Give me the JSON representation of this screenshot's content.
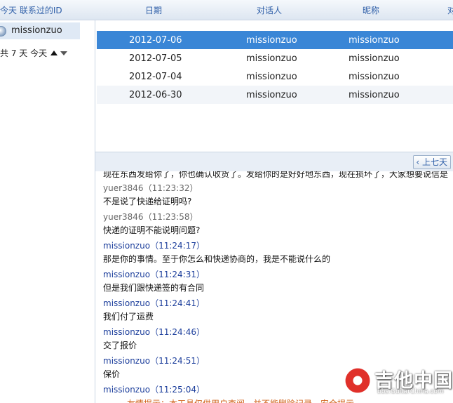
{
  "left_header": {
    "label": "今天 联系过的ID"
  },
  "contacts": [
    {
      "name": "missionzuo"
    }
  ],
  "range": {
    "text": "共 7 天 今天"
  },
  "table": {
    "columns": [
      "日期",
      "对话人",
      "昵称",
      "对"
    ],
    "rows": [
      {
        "date": "2012-07-06",
        "peer": "missionzuo",
        "nick": "missionzuo"
      },
      {
        "date": "2012-07-05",
        "peer": "missionzuo",
        "nick": "missionzuo"
      },
      {
        "date": "2012-07-04",
        "peer": "missionzuo",
        "nick": "missionzuo"
      },
      {
        "date": "2012-06-30",
        "peer": "missionzuo",
        "nick": "missionzuo"
      }
    ],
    "selected_index": 0
  },
  "pager": {
    "prev_label": "上七天"
  },
  "chat": {
    "top_cut": "现在东西发给你了，你也确认收货了。发给你的是好好地东西，现在损坏了，大家想要说信是",
    "messages": [
      {
        "sender": "yuer3846",
        "time": "（11:23:32）",
        "self": false,
        "text": "不是说了快递给证明吗?"
      },
      {
        "sender": "yuer3846",
        "time": "（11:23:58）",
        "self": false,
        "text": "快递的证明不能说明问题?"
      },
      {
        "sender": "missionzuo",
        "time": "（11:24:17）",
        "self": true,
        "text": "那是你的事情。至于你怎么和快递协商的，我是不能说什么的"
      },
      {
        "sender": "missionzuo",
        "time": "（11:24:31）",
        "self": true,
        "text": "但是我们跟快递签的有合同"
      },
      {
        "sender": "missionzuo",
        "time": "（11:24:41）",
        "self": true,
        "text": "我们付了运费"
      },
      {
        "sender": "missionzuo",
        "time": "（11:24:46）",
        "self": true,
        "text": "交了报价"
      },
      {
        "sender": "missionzuo",
        "time": "（11:24:51）",
        "self": true,
        "text": "保价"
      },
      {
        "sender": "missionzuo",
        "time": "（11:25:04）",
        "self": true,
        "text": ""
      }
    ]
  },
  "notice": {
    "text": "友情提示：本工具仅供用户查阅，并不能删除记录。安全提示"
  },
  "watermark": {
    "title": "吉他中国",
    "url": "bbs.GuitarChina.com"
  }
}
